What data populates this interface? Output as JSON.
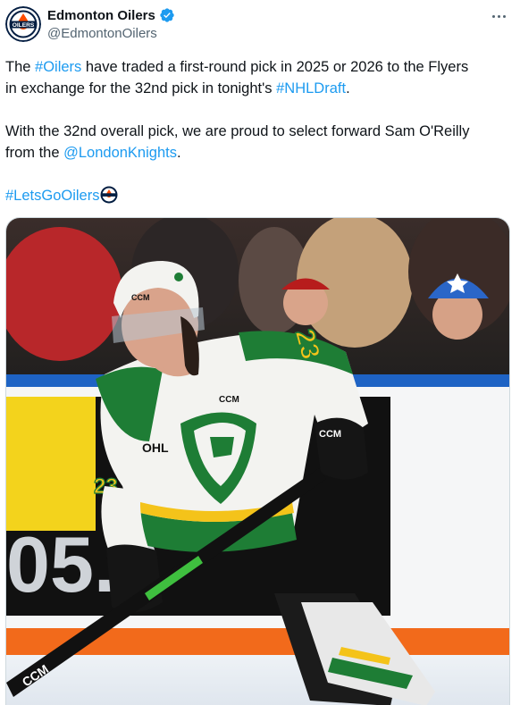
{
  "account": {
    "display_name": "Edmonton Oilers",
    "handle": "@EdmontonOilers",
    "avatar_text": "OILERS",
    "verified_icon": "verified-badge-icon",
    "more_icon": "more-options-icon"
  },
  "tweet": {
    "p1": {
      "t1": "The ",
      "l1": "#Oilers",
      "t2": " have traded a first-round pick in 2025 or 2026 to the Flyers",
      "t3": "in exchange for the 32nd pick in tonight's ",
      "l2": "#NHLDraft",
      "t4": "."
    },
    "p2": {
      "t1": "With the 32nd overall pick, we are proud to select forward Sam O'Reilly",
      "t2": "from the ",
      "l1": "@LondonKnights",
      "t3": "."
    },
    "p3": {
      "l1": "#LetsGoOilers"
    }
  },
  "media": {
    "board_text": "05.9",
    "jersey_number": "23",
    "brand_text": "CCM",
    "league_text": "OHL",
    "colors": {
      "knights_green": "#1e7d35",
      "knights_gold": "#f4c31a",
      "oilers_blue": "#041e42",
      "oilers_orange": "#ff4c00",
      "link_blue": "#1d9bf0"
    }
  }
}
